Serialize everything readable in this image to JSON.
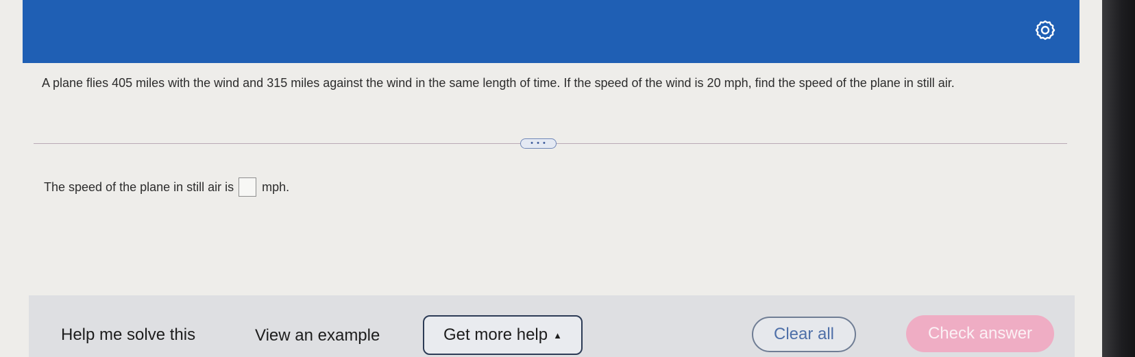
{
  "question": {
    "text": "A plane flies 405 miles with the wind and 315 miles against the wind in the same length of time. If the speed of the wind is 20 mph, find the speed of the plane in still air."
  },
  "expand": {
    "label": "• • •"
  },
  "answer": {
    "prefix": "The speed of the plane in still air is",
    "value": "",
    "suffix": "mph."
  },
  "footer": {
    "help_me_solve": "Help me solve this",
    "view_example": "View an example",
    "more_help": "Get more help",
    "clear_all": "Clear all",
    "check_answer": "Check answer"
  },
  "icons": {
    "settings": "gear-icon",
    "caret": "caret-up-icon"
  },
  "colors": {
    "header": "#1f5fb4",
    "check_answer": "#efadc4",
    "clear_all_text": "#4e6fa8"
  }
}
